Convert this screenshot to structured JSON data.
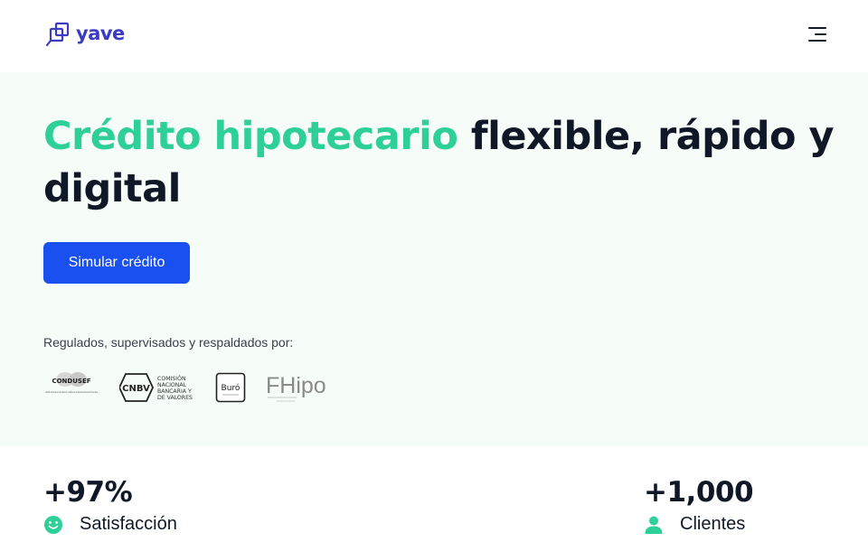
{
  "header": {
    "brand": "yave",
    "menu_icon": "hamburger-menu-icon"
  },
  "hero": {
    "headline_accent": "Crédito hipotecario",
    "headline_rest": " flexible, rápido y digital",
    "cta_label": "Simular crédito",
    "regulated_label": "Regulados, supervisados y respaldados por:",
    "regulators": {
      "condusef": "CONDUSEF",
      "condusef_sub": "Comisión Nacional para la Protección y Defensa de los Usuarios de Servicios Financieros",
      "cnbv_mark": "CNBV",
      "cnbv_name": [
        "COMISIÓN",
        "NACIONAL",
        "BANCARIA Y",
        "DE VALORES"
      ],
      "buro": "Buró",
      "fhipo": "FHipo"
    }
  },
  "stats": [
    {
      "value": "+97%",
      "label": "Satisfacción",
      "icon": "smiley-icon"
    },
    {
      "value": "+1,000",
      "label": "Clientes",
      "icon": "user-icon"
    }
  ],
  "colors": {
    "accent": "#2fcf98",
    "brand": "#3b3bc4",
    "cta": "#1a4ff0",
    "text": "#101828"
  }
}
